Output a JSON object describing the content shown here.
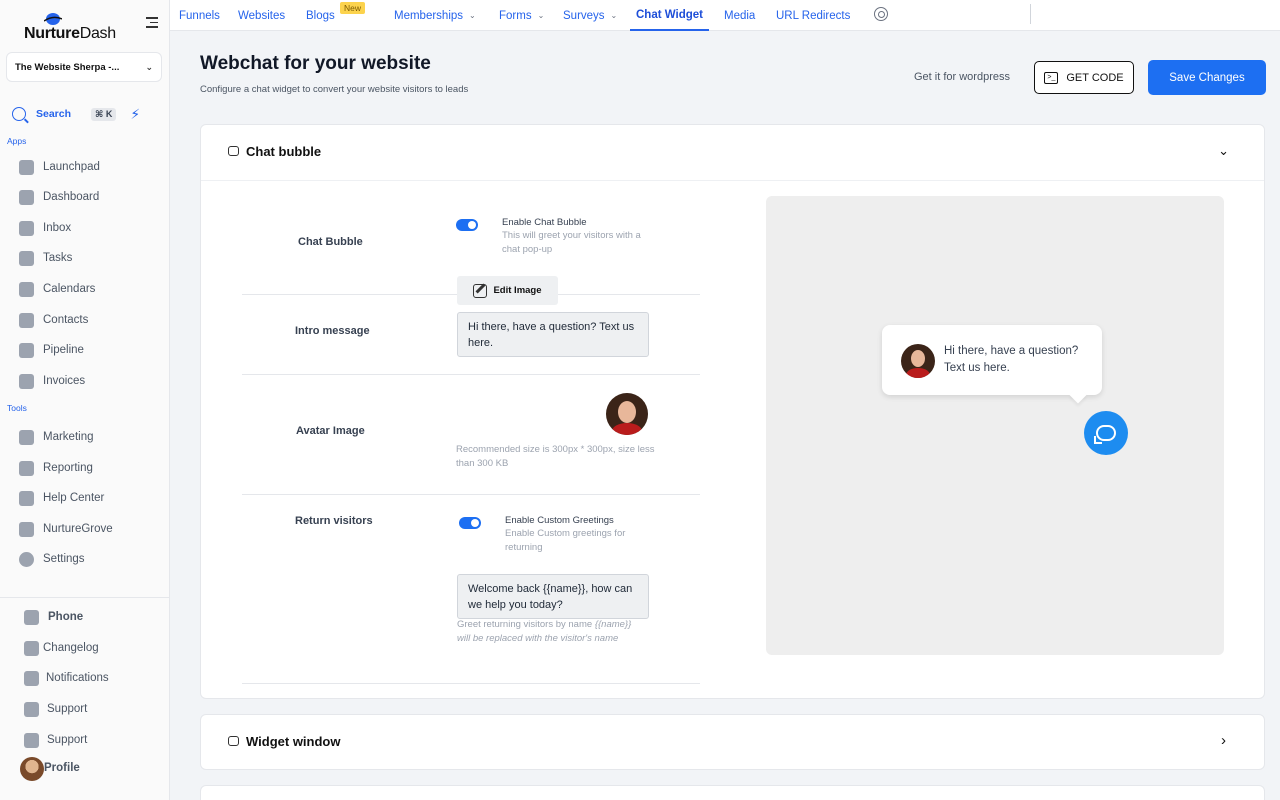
{
  "brand": {
    "name_bold": "Nurture",
    "name_light": "Dash"
  },
  "account": {
    "name": "The Website Sherpa -..."
  },
  "search": {
    "label": "Search",
    "shortcut": "⌘ K"
  },
  "sidebar": {
    "apps_label": "Apps",
    "apps": [
      {
        "label": "Launchpad",
        "icon": "rocket-icon"
      },
      {
        "label": "Dashboard",
        "icon": "dashboard-icon"
      },
      {
        "label": "Inbox",
        "icon": "inbox-icon"
      },
      {
        "label": "Tasks",
        "icon": "clipboard-icon"
      },
      {
        "label": "Calendars",
        "icon": "calendar-icon"
      },
      {
        "label": "Contacts",
        "icon": "person-icon"
      },
      {
        "label": "Pipeline",
        "icon": "funnel-icon"
      },
      {
        "label": "Invoices",
        "icon": "invoice-icon"
      }
    ],
    "tools_label": "Tools",
    "tools": [
      {
        "label": "Marketing",
        "icon": "megaphone-icon"
      },
      {
        "label": "Reporting",
        "icon": "pie-chart-icon"
      },
      {
        "label": "Help Center",
        "icon": "handshake-icon"
      },
      {
        "label": "NurtureGrove",
        "icon": "bird-icon"
      },
      {
        "label": "Settings",
        "icon": "gear-icon"
      }
    ],
    "bottom": [
      {
        "label": "Phone",
        "icon": "phone-icon"
      },
      {
        "label": "Changelog",
        "icon": "changelog-icon"
      },
      {
        "label": "Notifications",
        "icon": "bell-icon"
      },
      {
        "label": "Support",
        "icon": "chat-icon"
      },
      {
        "label": "Support",
        "icon": "chat-icon"
      },
      {
        "label": "Profile",
        "icon": "avatar-icon"
      }
    ]
  },
  "topnav": {
    "tabs": [
      {
        "label": "Funnels"
      },
      {
        "label": "Websites"
      },
      {
        "label": "Blogs",
        "badge": "New"
      },
      {
        "label": "Memberships",
        "dropdown": true
      },
      {
        "label": "Forms",
        "dropdown": true
      },
      {
        "label": "Surveys",
        "dropdown": true
      },
      {
        "label": "Chat Widget",
        "active": true
      },
      {
        "label": "Media"
      },
      {
        "label": "URL Redirects"
      }
    ]
  },
  "header": {
    "title": "Webchat for your website",
    "subtitle": "Configure a chat widget to convert your website visitors to leads",
    "wordpress_link": "Get it for wordpress",
    "get_code": "GET CODE",
    "save": "Save Changes"
  },
  "chat_bubble_card": {
    "title": "Chat bubble",
    "chat_bubble": {
      "label": "Chat Bubble",
      "toggle_title": "Enable Chat Bubble",
      "toggle_desc": "This will greet your visitors with a chat pop-up",
      "enabled": true
    },
    "intro": {
      "label": "Intro message",
      "value": "Hi there, have a question? Text us here."
    },
    "avatar": {
      "label": "Avatar Image",
      "edit": "Edit Image",
      "hint": "Recommended size is 300px * 300px, size less than 300 KB"
    },
    "return_visitors": {
      "label": "Return visitors",
      "toggle_title": "Enable Custom Greetings",
      "toggle_desc": "Enable Custom greetings for returning",
      "enabled": true,
      "value": "Welcome back {{name}}, how can we help you today?",
      "hint_prefix": "Greet returning visitors by name",
      "hint_var": "{{name}}",
      "hint_suffix": "will be replaced with the visitor's name"
    },
    "preview": {
      "bubble_text": "Hi there, have a question? Text us here."
    }
  },
  "widget_window_card": {
    "title": "Widget window"
  },
  "colors": {
    "accent": "#1d6ff2",
    "link": "#2563eb",
    "launcher": "#1d8cf0"
  }
}
